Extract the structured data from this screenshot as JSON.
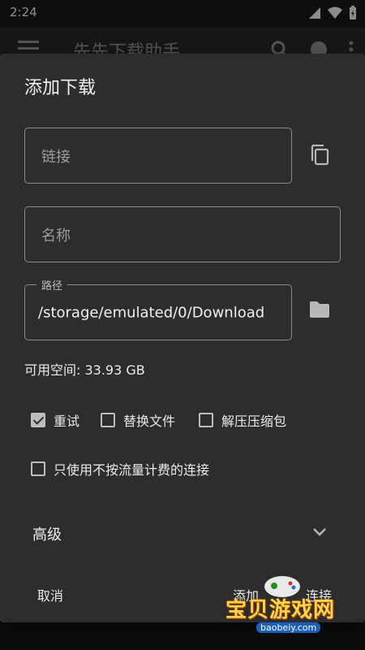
{
  "status_bar": {
    "time": "2:24"
  },
  "app_bar": {
    "title": "先先下载助手"
  },
  "dialog": {
    "title": "添加下载",
    "link_placeholder": "链接",
    "name_placeholder": "名称",
    "path_label": "路径",
    "path_value": "/storage/emulated/0/Download",
    "free_space": "可用空间: 33.93 GB",
    "options": [
      {
        "label": "重试",
        "checked": true
      },
      {
        "label": "替换文件",
        "checked": false
      },
      {
        "label": "解压压缩包",
        "checked": false
      }
    ],
    "unmetered_only": {
      "label": "只使用不按流量计费的连接",
      "checked": false
    },
    "advanced_label": "高级",
    "cancel_label": "取消",
    "add_label": "添加",
    "connect_label": "连接"
  },
  "watermark": {
    "brand": "宝贝游戏网",
    "url": "baobeiy.com"
  },
  "colors": {
    "dialog_bg": "#2d2d2d",
    "outline": "#8a8a8a",
    "text": "#e6e6e6"
  }
}
